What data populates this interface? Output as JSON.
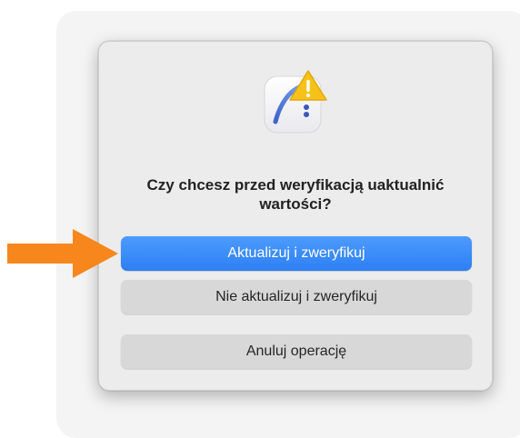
{
  "dialog": {
    "title": "Czy chcesz przed weryfikacją uaktualnić wartości?",
    "app_icon": "app-warning-icon",
    "buttons": {
      "primary": "Aktualizuj i zweryfikuj",
      "secondary": "Nie aktualizuj i zweryfikuj",
      "cancel": "Anuluj operację"
    }
  },
  "annotation": {
    "arrow_icon": "pointer-arrow-icon",
    "arrow_color": "#f7871d"
  },
  "colors": {
    "accent": "#2d7ff4",
    "warning": "#f6c21a"
  }
}
